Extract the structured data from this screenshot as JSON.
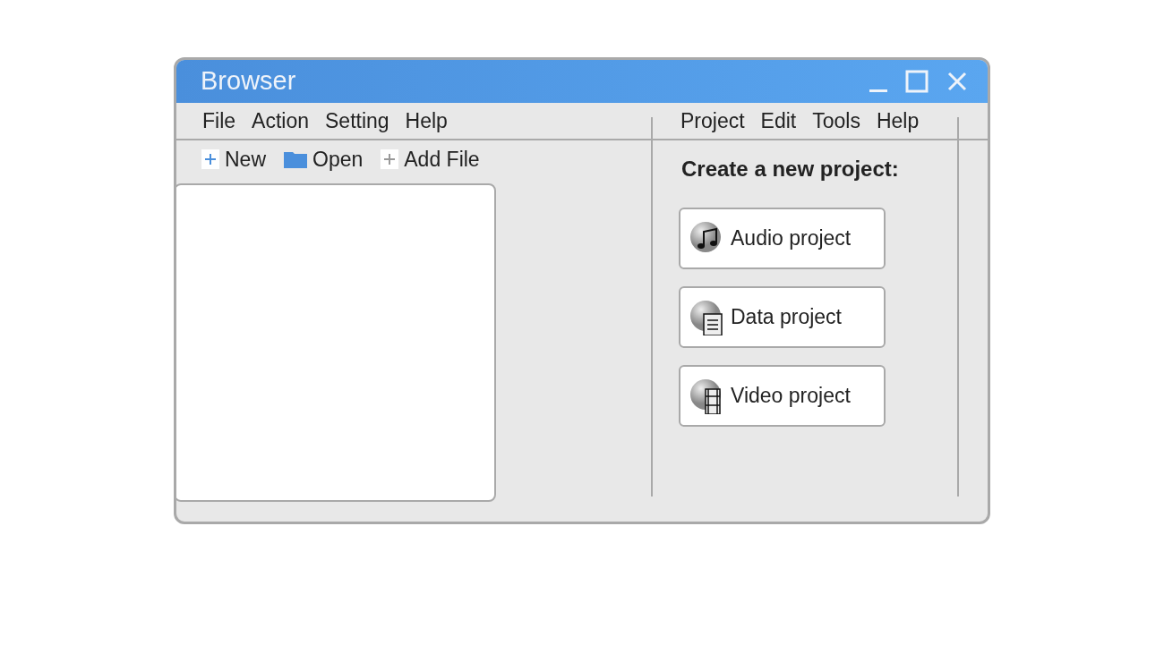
{
  "window": {
    "title": "Browser"
  },
  "left_menu": [
    "File",
    "Action",
    "Setting",
    "Help"
  ],
  "toolbar": [
    {
      "label": "New",
      "kind": "new"
    },
    {
      "label": "Open",
      "kind": "open"
    },
    {
      "label": "Add File",
      "kind": "add"
    }
  ],
  "right_menu": [
    "Project",
    "Edit",
    "Tools",
    "Help"
  ],
  "heading": "Create a new project:",
  "projects": [
    {
      "label": "Audio project",
      "kind": "audio"
    },
    {
      "label": "Data project",
      "kind": "data"
    },
    {
      "label": "Video project",
      "kind": "video"
    }
  ]
}
